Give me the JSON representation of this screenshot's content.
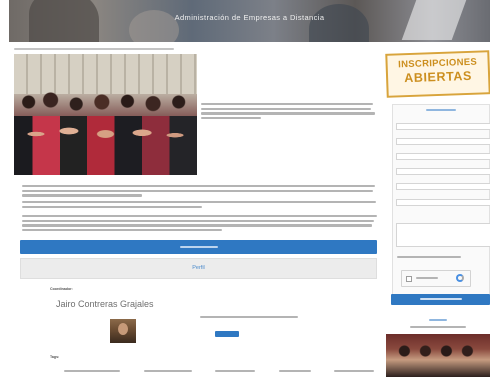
{
  "header": {
    "title": "Administración de Empresas a Distancia"
  },
  "sidebar": {
    "banner_line1": "INSCRIPCIONES",
    "banner_line2": "ABIERTAS",
    "accent_color": "#2f78c2",
    "banner_color": "#cc8f1f"
  },
  "main": {
    "perfil_label": "Perfil",
    "director_label": "Coordinador:",
    "director_name": "Jairo Contreras Grajales",
    "tags_label": "Tags:"
  },
  "icons": {
    "captcha": "recaptcha-icon",
    "photo": "class-photo"
  }
}
